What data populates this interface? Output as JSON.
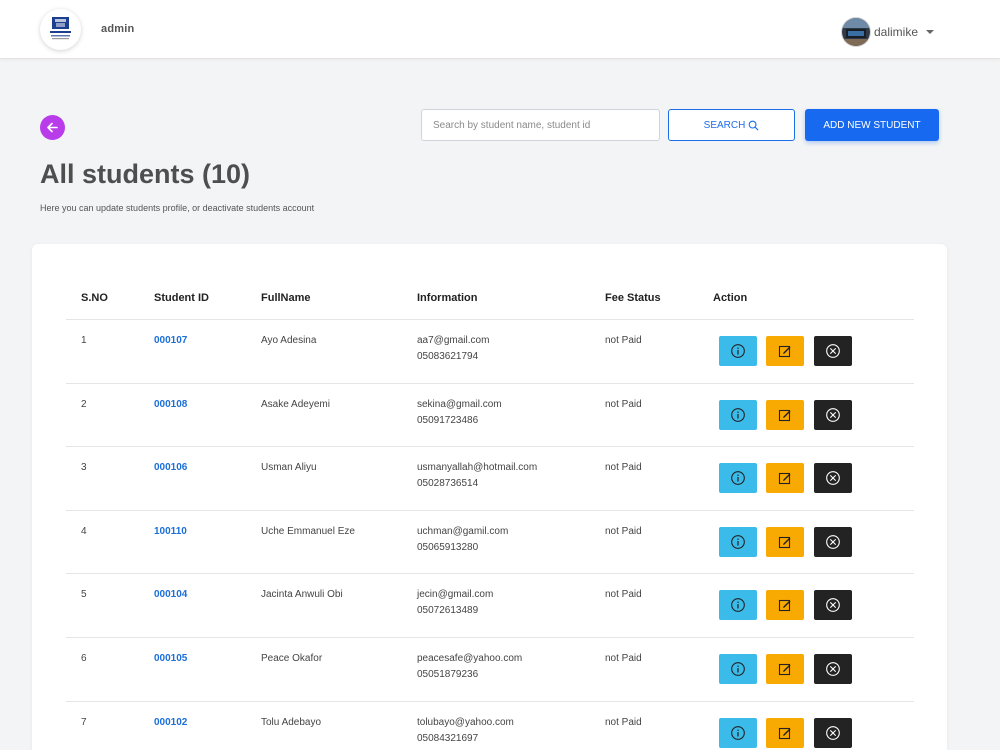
{
  "header": {
    "brand": "admin",
    "logo_icon": "university-logo-icon",
    "user_name": "dalimike"
  },
  "toolbar": {
    "search_placeholder": "Search by student name, student id",
    "search_label": "SEARCH",
    "add_label": "ADD NEW STUDENT",
    "back_icon": "arrow-left-icon"
  },
  "page": {
    "title": "All students (10)",
    "subtitle": "Here you can update students profile, or deactivate students account"
  },
  "table": {
    "headers": {
      "sno": "S.NO",
      "id": "Student ID",
      "name": "FullName",
      "info": "Information",
      "fee": "Fee Status",
      "action": "Action"
    },
    "rows": [
      {
        "sno": "1",
        "id": "000107",
        "name": "Ayo Adesina",
        "email": "aa7@gmail.com",
        "phone": "05083621794",
        "fee": "not Paid"
      },
      {
        "sno": "2",
        "id": "000108",
        "name": "Asake Adeyemi",
        "email": "sekina@gmail.com",
        "phone": "05091723486",
        "fee": "not Paid"
      },
      {
        "sno": "3",
        "id": "000106",
        "name": "Usman Aliyu",
        "email": "usmanyallah@hotmail.com",
        "phone": "05028736514",
        "fee": "not Paid"
      },
      {
        "sno": "4",
        "id": "100110",
        "name": "Uche Emmanuel Eze",
        "email": "uchman@gamil.com",
        "phone": "05065913280",
        "fee": "not Paid"
      },
      {
        "sno": "5",
        "id": "000104",
        "name": "Jacinta Anwuli Obi",
        "email": "jecin@gmail.com",
        "phone": "05072613489",
        "fee": "not Paid"
      },
      {
        "sno": "6",
        "id": "000105",
        "name": "Peace Okafor",
        "email": "peacesafe@yahoo.com",
        "phone": "05051879236",
        "fee": "not Paid"
      },
      {
        "sno": "7",
        "id": "000102",
        "name": "Tolu Adebayo",
        "email": "tolubayo@yahoo.com",
        "phone": "05084321697",
        "fee": "not Paid"
      }
    ],
    "action_icons": {
      "info": "info-icon",
      "edit": "edit-icon",
      "delete": "close-circle-icon"
    }
  },
  "colors": {
    "back_button": "#b83ce9",
    "primary": "#1769f0",
    "link": "#1b6fd8",
    "info_button": "#3bbbe9",
    "edit_button": "#f8a902",
    "delete_button": "#232323"
  }
}
